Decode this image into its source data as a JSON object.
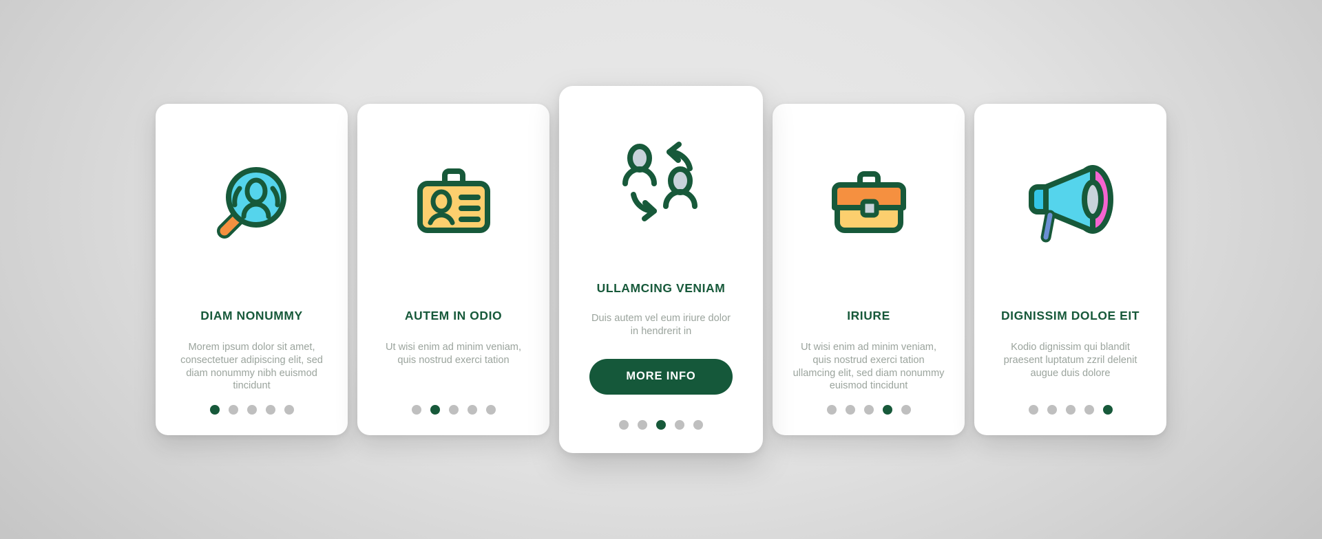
{
  "palette": {
    "brand_green": "#17593a",
    "muted_text": "#9ba49d",
    "dot_inactive": "#bfbfbf",
    "card_bg": "#ffffff",
    "cyan": "#55d4ec",
    "orange": "#f59040",
    "yellow": "#fccf6e",
    "magenta": "#f564d0",
    "gray_blue": "#c8d3db",
    "page_bg": "#e4e4e4"
  },
  "cards": [
    {
      "icon": "magnifier-person-icon",
      "title": "DIAM NONUMMY",
      "description": "Morem ipsum dolor sit amet, consectetuer adipiscing elit, sed diam nonummy nibh euismod tincidunt",
      "featured": false,
      "dots": {
        "count": 5,
        "active_index": 0
      }
    },
    {
      "icon": "id-badge-icon",
      "title": "AUTEM IN ODIO",
      "description": "Ut wisi enim ad minim veniam, quis nostrud exerci tation",
      "featured": false,
      "dots": {
        "count": 5,
        "active_index": 1
      }
    },
    {
      "icon": "people-exchange-icon",
      "title": "ULLAMCING VENIAM",
      "description": "Duis autem vel eum iriure dolor in hendrerit in",
      "featured": true,
      "button_label": "MORE INFO",
      "dots": {
        "count": 5,
        "active_index": 2
      }
    },
    {
      "icon": "briefcase-icon",
      "title": "IRIURE",
      "description": "Ut wisi enim ad minim veniam, quis nostrud exerci tation ullamcing elit, sed diam nonummy euismod tincidunt",
      "featured": false,
      "dots": {
        "count": 5,
        "active_index": 3
      }
    },
    {
      "icon": "megaphone-icon",
      "title": "DIGNISSIM DOLOE EIT",
      "description": "Kodio dignissim qui blandit praesent luptatum zzril delenit augue duis dolore",
      "featured": false,
      "dots": {
        "count": 5,
        "active_index": 4
      }
    }
  ]
}
